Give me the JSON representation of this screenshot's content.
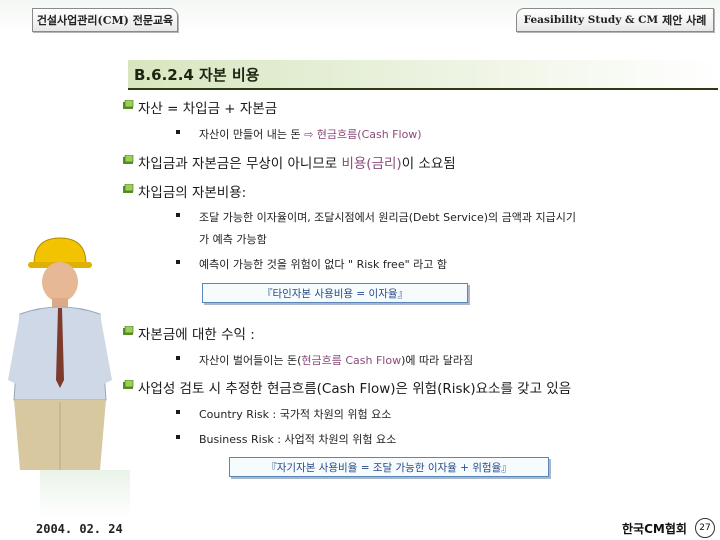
{
  "header": {
    "left_title": "건설사업관리(CM) 전문교육",
    "right_title_latin": "Feasibility Study & CM",
    "right_title_korean": "제안 사례"
  },
  "section": {
    "title": "B.6.2.4  자본 비용"
  },
  "content": {
    "items": [
      {
        "level": 1,
        "text": "자산 = 차입금 + 자본금"
      },
      {
        "level": 2,
        "text_before": "자산이 만들어 내는 돈 ",
        "arrow": "⇨",
        "highlight": " 현금흐름(Cash Flow)"
      },
      {
        "level": 1,
        "text_before": "차입금과 자본금은 무상이 아니므로 ",
        "highlight": "비용(금리)",
        "text_after": "이 소요됨"
      },
      {
        "level": 1,
        "text": "차입금의 자본비용:"
      },
      {
        "level": 2,
        "line1": "조달 가능한 이자율이며, 조달시점에서 원리금(Debt Service)의 금액과 지급시기",
        "line2": "가 예측 가능함"
      },
      {
        "level": 2,
        "text": "예측이 가능한 것을 위험이 없다 \" Risk free\" 라고 함"
      },
      {
        "level": 1,
        "text": "자본금에 대한 수익 :"
      },
      {
        "level": 2,
        "text_before": "자산이 벌어들이는 돈(",
        "highlight": "현금흐름 Cash Flow",
        "text_after": ")에 따라 달라짐"
      },
      {
        "level": 1,
        "text": "사업성 검토 시 추정한 현금흐름(Cash Flow)은 위험(Risk)요소를 갖고 있음"
      },
      {
        "level": 2,
        "text": "Country Risk : 국가적 차원의 위험 요소"
      },
      {
        "level": 2,
        "text": "Business Risk : 사업적 차원의 위험 요소"
      }
    ],
    "callouts": [
      {
        "text": "『타인자본 사용비용 = 이자율』"
      },
      {
        "text": "『자기자본 사용비율 = 조달 가능한 이자율 + 위험율』"
      }
    ]
  },
  "footer": {
    "date": "2004. 02. 24",
    "org": "한국CM협회",
    "page": "27"
  },
  "colors": {
    "title_band": "#d7e6bf",
    "bullet_green": "#5b8f2a",
    "highlight": "#8a4a7a",
    "callout_border": "#5b87b8"
  },
  "icons": {
    "level1_bullet": "green-book-icon",
    "level2_bullet": "square-bullet",
    "illustration": "construction-worker-hardhat"
  }
}
